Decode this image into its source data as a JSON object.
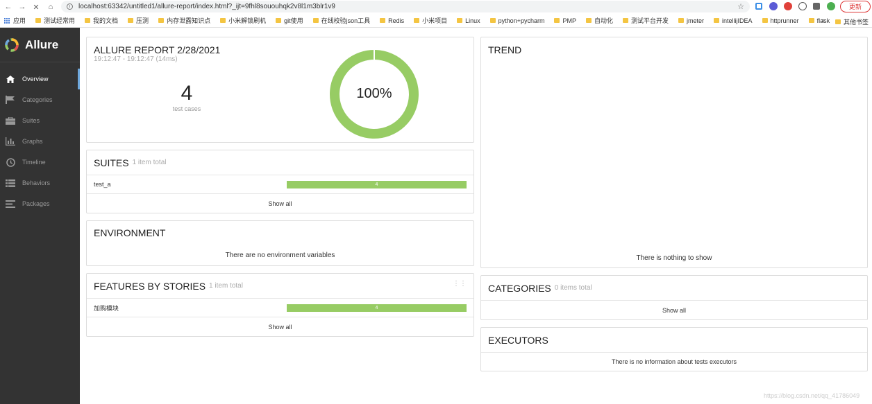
{
  "browser": {
    "url": "localhost:63342/untitled1/allure-report/index.html?_ijt=9fhl8sououhqk2v8l1m3blr1v9",
    "update_label": "更新",
    "bookmarks": [
      "应用",
      "测试经常用",
      "我的文档",
      "压测",
      "内存泄露知识点",
      "小米解锁刷机",
      "git使用",
      "在线校验json工具",
      "Redis",
      "小米项目",
      "Linux",
      "python+pycharm",
      "PMP",
      "自动化",
      "测试平台开发",
      "jmeter",
      "intellijIDEA",
      "httprunner",
      "flask"
    ],
    "more": "»",
    "other_bookmarks": "其他书签"
  },
  "sidebar": {
    "brand": "Allure",
    "items": [
      {
        "label": "Overview",
        "icon": "home-icon"
      },
      {
        "label": "Categories",
        "icon": "flag-icon"
      },
      {
        "label": "Suites",
        "icon": "briefcase-icon"
      },
      {
        "label": "Graphs",
        "icon": "bar-chart-icon"
      },
      {
        "label": "Timeline",
        "icon": "clock-icon"
      },
      {
        "label": "Behaviors",
        "icon": "list-icon"
      },
      {
        "label": "Packages",
        "icon": "lines-icon"
      }
    ]
  },
  "summary": {
    "title": "ALLURE REPORT 2/28/2021",
    "time_range": "19:12:47 - 19:12:47 (14ms)",
    "test_count": "4",
    "test_count_label": "test cases",
    "pass_rate": "100%",
    "pass_fraction": 1.0
  },
  "suites": {
    "title": "SUITES",
    "subtitle": "1 item total",
    "rows": [
      {
        "name": "test_a",
        "count": "4"
      }
    ],
    "show_all": "Show all"
  },
  "environment": {
    "title": "ENVIRONMENT",
    "message": "There are no environment variables"
  },
  "features": {
    "title": "FEATURES BY STORIES",
    "subtitle": "1 item total",
    "rows": [
      {
        "name": "加购模块",
        "count": "4"
      }
    ],
    "show_all": "Show all"
  },
  "trend": {
    "title": "TREND",
    "message": "There is nothing to show"
  },
  "categories": {
    "title": "CATEGORIES",
    "subtitle": "0 items total",
    "show_all": "Show all"
  },
  "executors": {
    "title": "EXECUTORS",
    "message": "There is no information about tests executors"
  },
  "watermark": "https://blog.csdn.net/qq_41786049",
  "colors": {
    "passed": "#97cc64",
    "sidebar_bg": "#333333",
    "active_accent": "#6fa8dc"
  }
}
